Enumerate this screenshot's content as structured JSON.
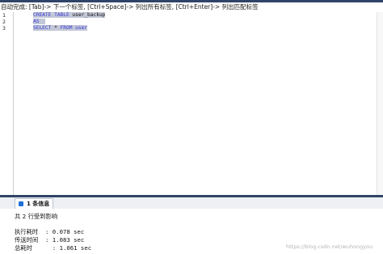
{
  "hint_bar": {
    "text": "自动完成: [Tab]-> 下一个标签, [Ctrl+Space]-> 列出所有标签, [Ctrl+Enter]-> 列出匹配标签"
  },
  "editor": {
    "line_numbers": [
      "1",
      "2",
      "3"
    ],
    "lines": [
      {
        "keyword1": "CREATE TABLE",
        "rest": " user_backup"
      },
      {
        "keyword1": "AS",
        "rest": ""
      },
      {
        "keyword1": "SELECT",
        "mid": " * ",
        "keyword2": "FROM",
        "rest": " user"
      }
    ]
  },
  "results_panel": {
    "tab_label": "1 条信息",
    "affected_rows": "共 2 行受到影响",
    "stats": [
      {
        "label": "执行耗时",
        "value": ": 0.078 sec"
      },
      {
        "label": "传送时间",
        "value": ": 1.083 sec"
      },
      {
        "label": "总耗时",
        "value": "  : 1.061 sec"
      }
    ]
  },
  "watermark": "https://blog.csdn.net/wuhongyou"
}
